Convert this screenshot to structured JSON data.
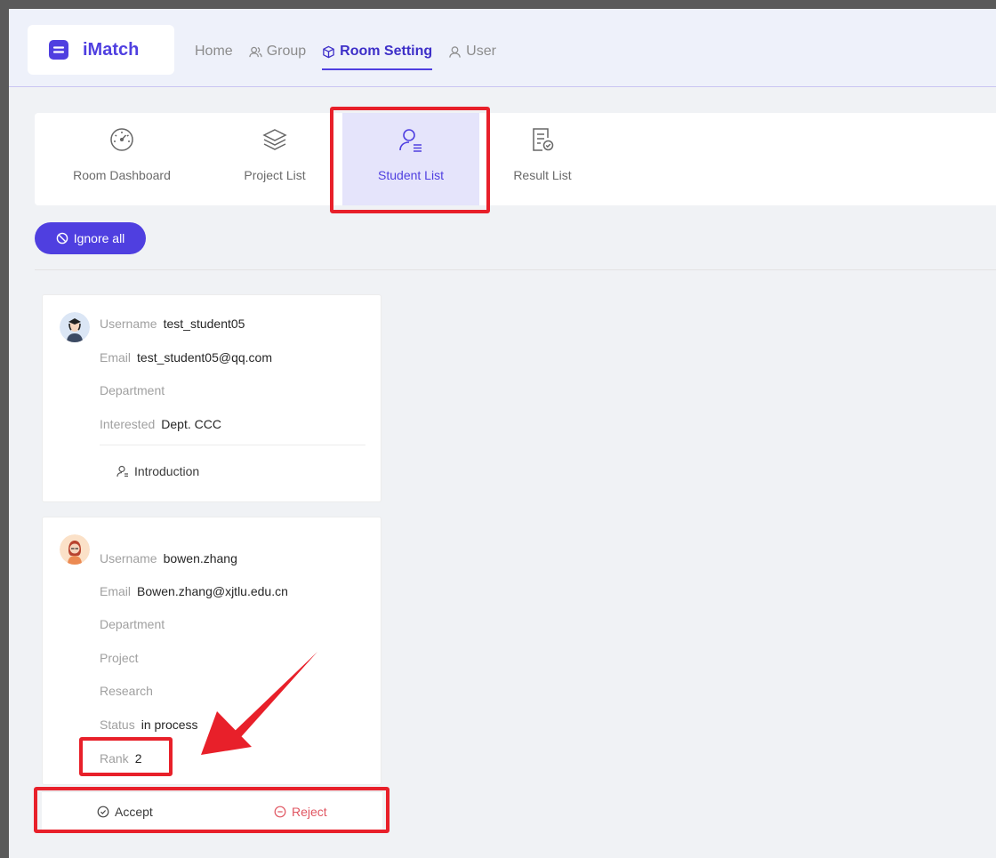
{
  "app": {
    "logo_text": "iMatch",
    "brand_color": "#4f3fe0"
  },
  "nav": {
    "home": "Home",
    "group": "Group",
    "room_setting": "Room Setting",
    "user": "User",
    "active": "Room Setting"
  },
  "tabs": [
    {
      "label": "Room Dashboard",
      "icon": "dashboard-icon"
    },
    {
      "label": "Project List",
      "icon": "layers-icon"
    },
    {
      "label": "Student List",
      "icon": "user-list-icon",
      "active": true
    },
    {
      "label": "Result List",
      "icon": "document-check-icon"
    }
  ],
  "toolbar": {
    "ignore_all_label": "Ignore all"
  },
  "students": [
    {
      "username_label": "Username",
      "username": "test_student05",
      "email_label": "Email",
      "email": "test_student05@qq.com",
      "department_label": "Department",
      "department": "",
      "interested_label": "Interested",
      "interested": "Dept. CCC",
      "intro_label": "Introduction"
    },
    {
      "username_label": "Username",
      "username": "bowen.zhang",
      "email_label": "Email",
      "email": "Bowen.zhang@xjtlu.edu.cn",
      "department_label": "Department",
      "department": "",
      "project_label": "Project",
      "project": "",
      "research_label": "Research",
      "research": "",
      "status_label": "Status",
      "status": "in process",
      "rank_label": "Rank",
      "rank": "2",
      "accept_label": "Accept",
      "reject_label": "Reject"
    }
  ],
  "annotation_color": "#e8202a"
}
